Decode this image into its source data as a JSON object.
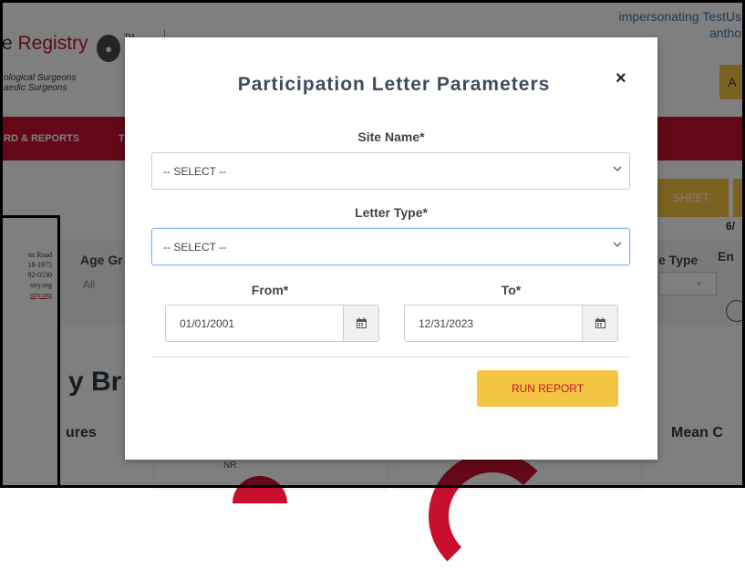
{
  "background": {
    "impersonating_line1": "impersonating TestUs",
    "impersonating_line2": "antho",
    "logo_prefix": "e ",
    "logo_registry": "Registry",
    "logo_tm": "TM",
    "logo_subtitle_line1": "ological Surgeons",
    "logo_subtitle_line2": "aedic Surgeons",
    "orange_tab_text": "A",
    "nav_dashboard": "RD & REPORTS",
    "nav_next": "T",
    "sheet_button": "SHEET",
    "date_fragment": "6/",
    "age_group_label": "Age Gr",
    "age_group_value": "All",
    "type_label": "e Type",
    "en_label": "En",
    "big_title": "y Br",
    "section_left": "ures",
    "section_right": "Mean C",
    "nr_label": "NR",
    "letter_lines": [
      "ns Road",
      "18-1975",
      "92-0530",
      "stry.org",
      "stry.org"
    ]
  },
  "modal": {
    "title": "Participation Letter Parameters",
    "close_label": "×",
    "site_name_label": "Site Name*",
    "site_name_value": "-- SELECT --",
    "letter_type_label": "Letter Type*",
    "letter_type_value": "-- SELECT --",
    "from_label": "From*",
    "from_value": "01/01/2001",
    "to_label": "To*",
    "to_value": "12/31/2023",
    "run_button": "RUN REPORT"
  },
  "colors": {
    "brand_red": "#c8102e",
    "accent_yellow": "#f4c542"
  },
  "icons": {
    "calendar": "calendar-icon",
    "chevron": "chevron-down-icon",
    "close": "close-icon"
  }
}
